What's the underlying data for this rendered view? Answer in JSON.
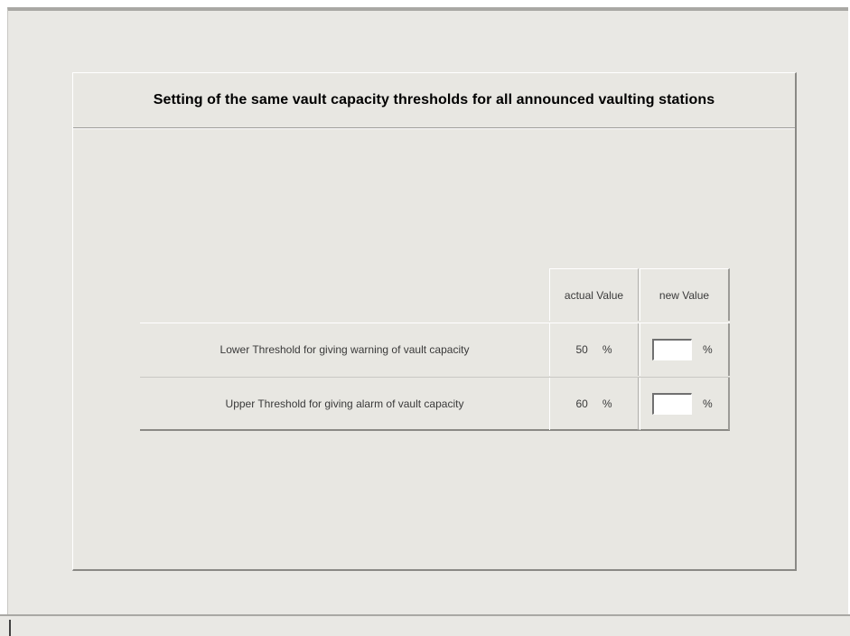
{
  "panel": {
    "title": "Setting of the same vault capacity thresholds for all announced vaulting stations"
  },
  "table": {
    "headers": {
      "actual": "actual Value",
      "new": "new Value"
    },
    "rows": [
      {
        "label": "Lower Threshold for giving warning of vault capacity",
        "actual_value": "50",
        "actual_unit": "%",
        "new_value": "",
        "new_unit": "%"
      },
      {
        "label": "Upper Threshold for giving alarm of vault capacity",
        "actual_value": "60",
        "actual_unit": "%",
        "new_value": "",
        "new_unit": "%"
      }
    ]
  }
}
